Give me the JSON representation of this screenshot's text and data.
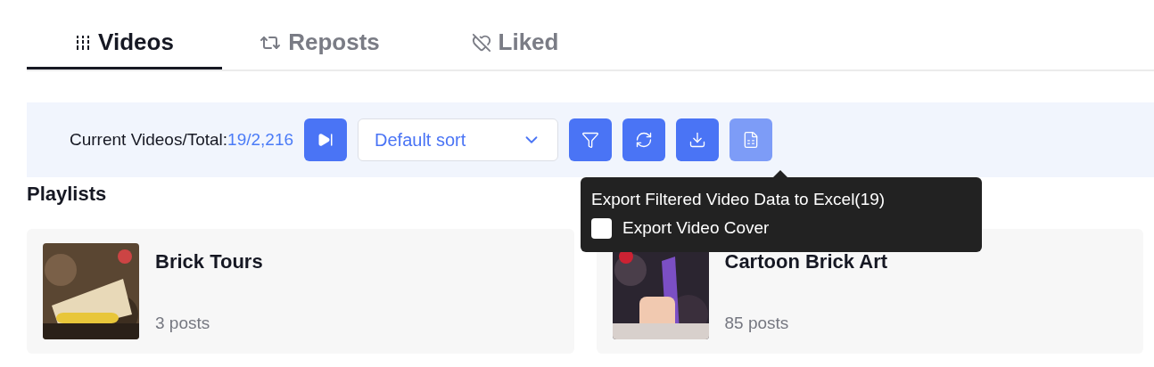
{
  "tabs": [
    {
      "kind": "videos",
      "label": "Videos",
      "selected": true
    },
    {
      "kind": "reposts",
      "label": "Reposts",
      "selected": false
    },
    {
      "kind": "liked",
      "label": "Liked",
      "selected": false
    }
  ],
  "toolbar": {
    "count_label": "Current Videos/Total:",
    "count_value": "19/2,216",
    "sort": {
      "value": "Default sort"
    },
    "buttons": [
      {
        "kind": "filter",
        "hovered": false
      },
      {
        "kind": "refresh",
        "hovered": false
      },
      {
        "kind": "download",
        "hovered": false
      },
      {
        "kind": "excel",
        "hovered": true
      }
    ]
  },
  "tooltip": {
    "title": "Export Filtered Video Data to Excel(19)",
    "option": {
      "label": "Export Video Cover",
      "checked": false
    }
  },
  "playlists": {
    "title": "Playlists",
    "items": [
      {
        "name": "Brick Tours",
        "posts": "3 posts",
        "kind": "picture"
      },
      {
        "name": "Cartoon Brick Art",
        "posts": "85 posts",
        "kind": "picture"
      }
    ]
  }
}
